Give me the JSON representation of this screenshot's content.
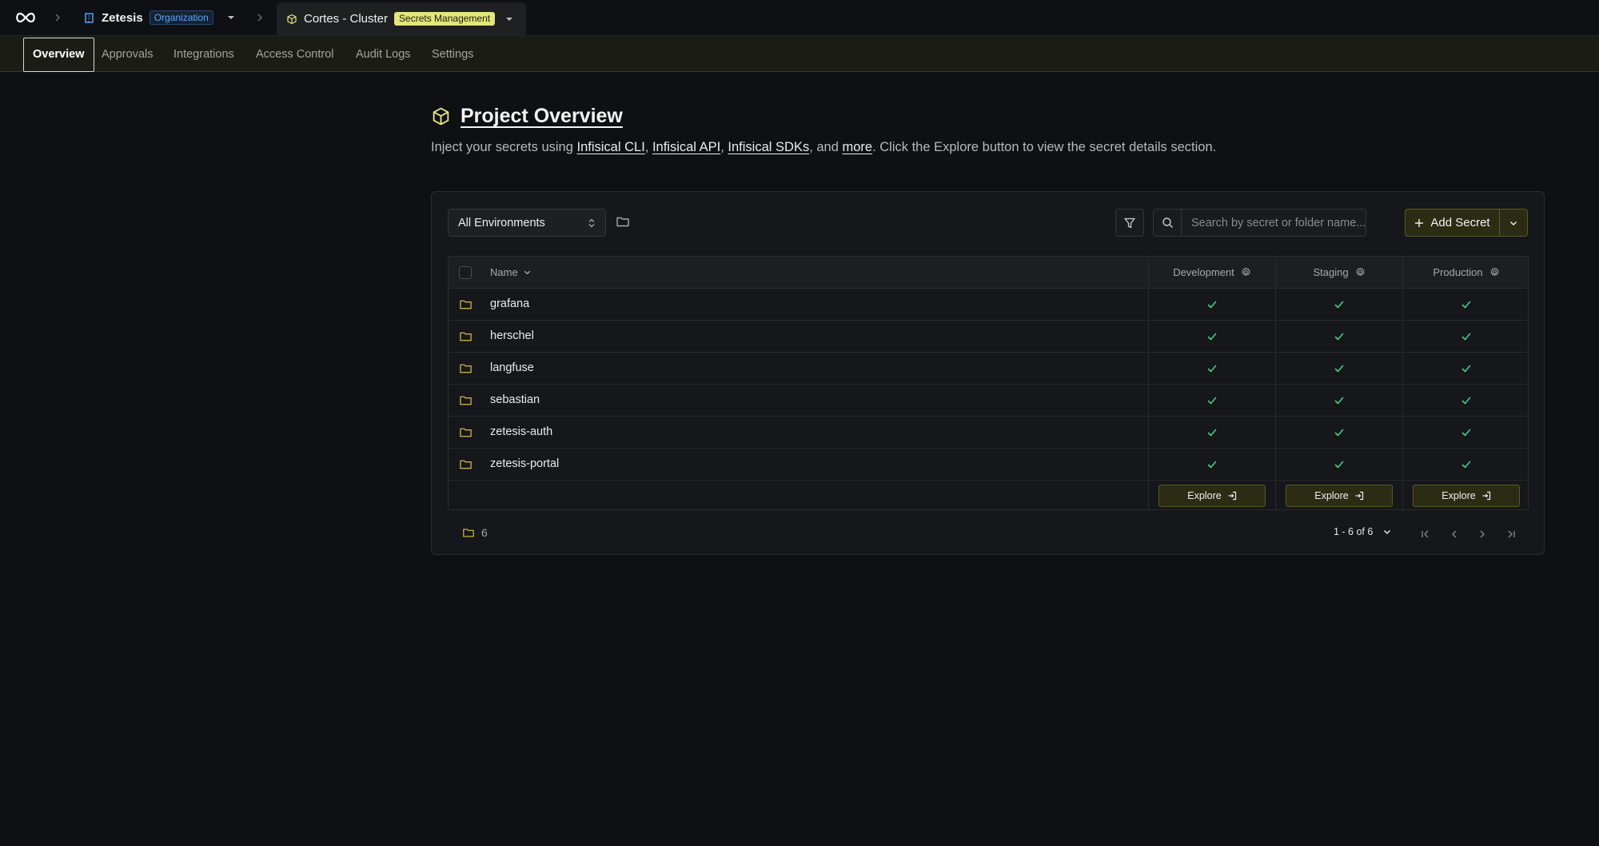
{
  "topbar": {
    "org_name": "Zetesis",
    "org_badge": "Organization",
    "project_name": "Cortes - Cluster",
    "project_badge": "Secrets Management"
  },
  "nav": {
    "items": [
      "Overview",
      "Approvals",
      "Integrations",
      "Access Control",
      "Audit Logs",
      "Settings"
    ],
    "active": "Overview"
  },
  "header": {
    "title": "Project Overview",
    "subtitle_prefix": "Inject your secrets using ",
    "link_cli": "Infisical CLI",
    "sep1": ", ",
    "link_api": "Infisical API",
    "sep2": ", ",
    "link_sdks": "Infisical SDKs",
    "sep3": ", and ",
    "link_more": "more",
    "subtitle_suffix": ". Click the Explore button to view the secret details section."
  },
  "toolbar": {
    "env_select_value": "All Environments",
    "search_placeholder": "Search by secret or folder name...",
    "add_secret_label": "Add Secret"
  },
  "table": {
    "col_name": "Name",
    "environments": [
      "Development",
      "Staging",
      "Production"
    ],
    "rows": [
      "grafana",
      "herschel",
      "langfuse",
      "sebastian",
      "zetesis-auth",
      "zetesis-portal"
    ],
    "explore_label": "Explore"
  },
  "footer": {
    "folder_count": "6",
    "pagination": "1 - 6 of 6"
  },
  "colors": {
    "accent_yellow": "#e3e67a",
    "check_green": "#3ecf8e",
    "folder_yellow": "#c9b348",
    "org_badge_blue": "#5aa8ff"
  }
}
